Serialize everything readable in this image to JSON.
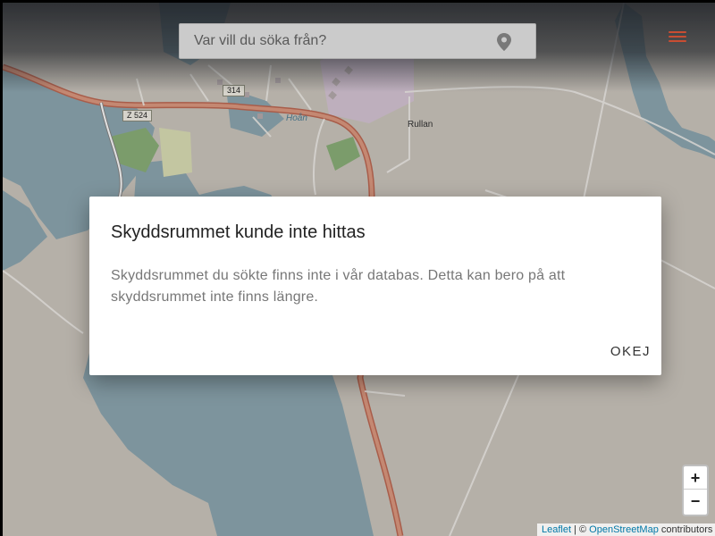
{
  "search": {
    "placeholder": "Var vill du söka från?",
    "pin_icon": "location-pin-icon"
  },
  "header": {
    "menu_icon": "hamburger-menu-icon",
    "accent_color": "#e5583a"
  },
  "map": {
    "labels": {
      "place_rullan": "Rullan",
      "water_hoan": "Hoån"
    },
    "road_shields": {
      "route_314": "314",
      "route_z524": "Z 524"
    }
  },
  "dialog": {
    "title": "Skyddsrummet kunde inte hittas",
    "body": "Skyddsrummet du sökte finns inte i vår databas. Detta kan bero på att skyddsrummet inte finns längre.",
    "ok_label": "OKEJ"
  },
  "zoom": {
    "in_label": "+",
    "out_label": "−"
  },
  "attribution": {
    "leaflet": "Leaflet",
    "separator": " | © ",
    "osm": "OpenStreetMap",
    "suffix": " contributors"
  }
}
